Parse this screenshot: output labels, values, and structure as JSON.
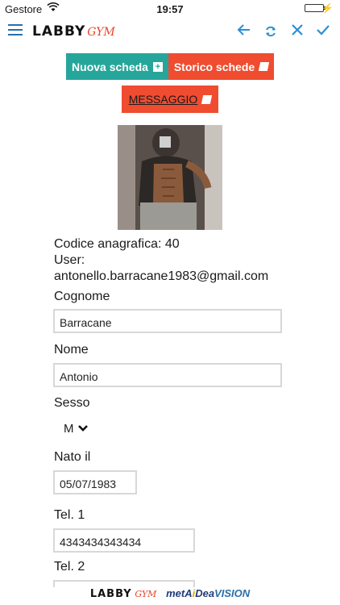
{
  "status": {
    "carrier": "Gestore",
    "time": "19:57"
  },
  "nav": {
    "logo_main": "LABBY",
    "logo_gym": "GYM",
    "icons": [
      "menu-icon",
      "back-arrow-icon",
      "refresh-icon",
      "close-icon",
      "check-icon"
    ]
  },
  "actions": {
    "new_card": "Nuova scheda",
    "history": "Storico schede",
    "message": "MESSAGGIO"
  },
  "profile": {
    "codice_label": "Codice anagrafica: 40",
    "user_label": "User:",
    "user_email": "antonello.barracane1983@gmail.com"
  },
  "form": {
    "cognome_label": "Cognome",
    "cognome_value": "Barracane",
    "nome_label": "Nome",
    "nome_value": "Antonio",
    "sesso_label": "Sesso",
    "sesso_value": "M",
    "nato_label": "Nato il",
    "nato_value": "05/07/1983",
    "tel1_label": "Tel. 1",
    "tel1_value": "4343434343434",
    "tel2_label": "Tel. 2",
    "tel2_value": ""
  },
  "footer": {
    "labby": "LABBY",
    "gym": "GYM",
    "met": "metA",
    "i": "i",
    "dea": "Dea",
    "vision": "VISION"
  },
  "colors": {
    "teal": "#26a69a",
    "orange": "#ef4c30",
    "accent_blue": "#2a8fd6"
  }
}
